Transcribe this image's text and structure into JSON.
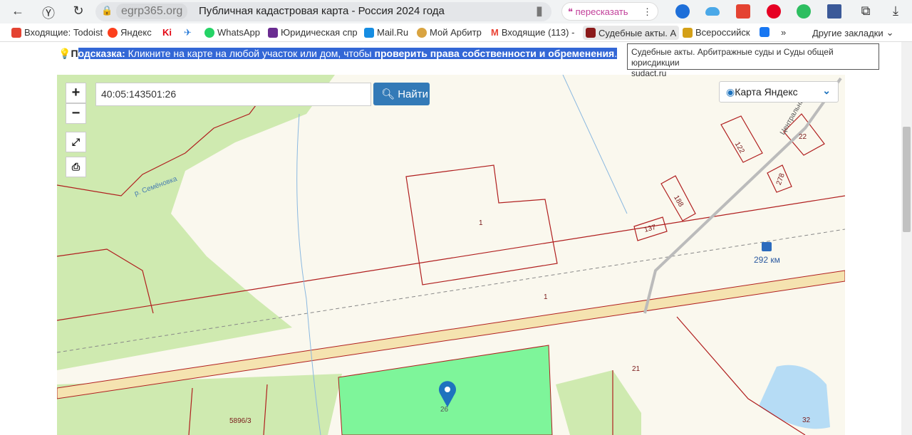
{
  "browser": {
    "domain": "egrp365.org",
    "title": "Публичная кадастровая карта - Россия 2024 года",
    "retell": "пересказать"
  },
  "bookmarks": [
    {
      "label": "Входящие: Todoist",
      "color": "#e44332"
    },
    {
      "label": "Яндекс",
      "color": "#fc3f1d"
    },
    {
      "label": "",
      "color": "#e30613"
    },
    {
      "label": "",
      "color": "#2a7bd8"
    },
    {
      "label": "WhatsApp",
      "color": "#25d366"
    },
    {
      "label": "Юридическая спр",
      "color": "#6a2c91"
    },
    {
      "label": "Mail.Ru",
      "color": "#168de2"
    },
    {
      "label": "Мой Арбитр",
      "color": "#d9a441"
    },
    {
      "label": "Входящие (113) -",
      "color": "#ea4335"
    },
    {
      "label": "Судебные акты. А",
      "color": "#8b1a1a"
    },
    {
      "label": "Всероссийск",
      "color": "#d4a017"
    },
    {
      "label": "",
      "color": "#1877f2"
    }
  ],
  "bookmarks_more": "»",
  "other_bookmarks": "Другие закладки",
  "hint": {
    "prefix": "П",
    "label": "одсказка:",
    "text": " Кликните на карте на любой участок или дом, чтобы ",
    "bold": "проверить права собственности и обременения",
    "end": "."
  },
  "tooltip": {
    "title": "Судебные акты. Арбитражные суды и Суды общей юрисдикции",
    "url": "sudact.ru"
  },
  "map": {
    "search_value": "40:05:143501:26",
    "find_label": "Найти",
    "zoom_in": "+",
    "zoom_out": "−",
    "layer": "Карта Яндекс",
    "labels": {
      "river": "р. Семёновка",
      "street": "Центральна",
      "p1": "1",
      "p122": "122",
      "p22": "22",
      "p278": "278",
      "p188": "188",
      "p137": "137",
      "km": "292 км",
      "line1": "1",
      "p21": "21",
      "p5896": "5896/3",
      "p26": "26",
      "p32": "32"
    },
    "colors": {
      "selected": "#7ef59a",
      "forest": "#cfeab0",
      "border": "#b01e1e",
      "water": "#b6dcf5"
    }
  }
}
